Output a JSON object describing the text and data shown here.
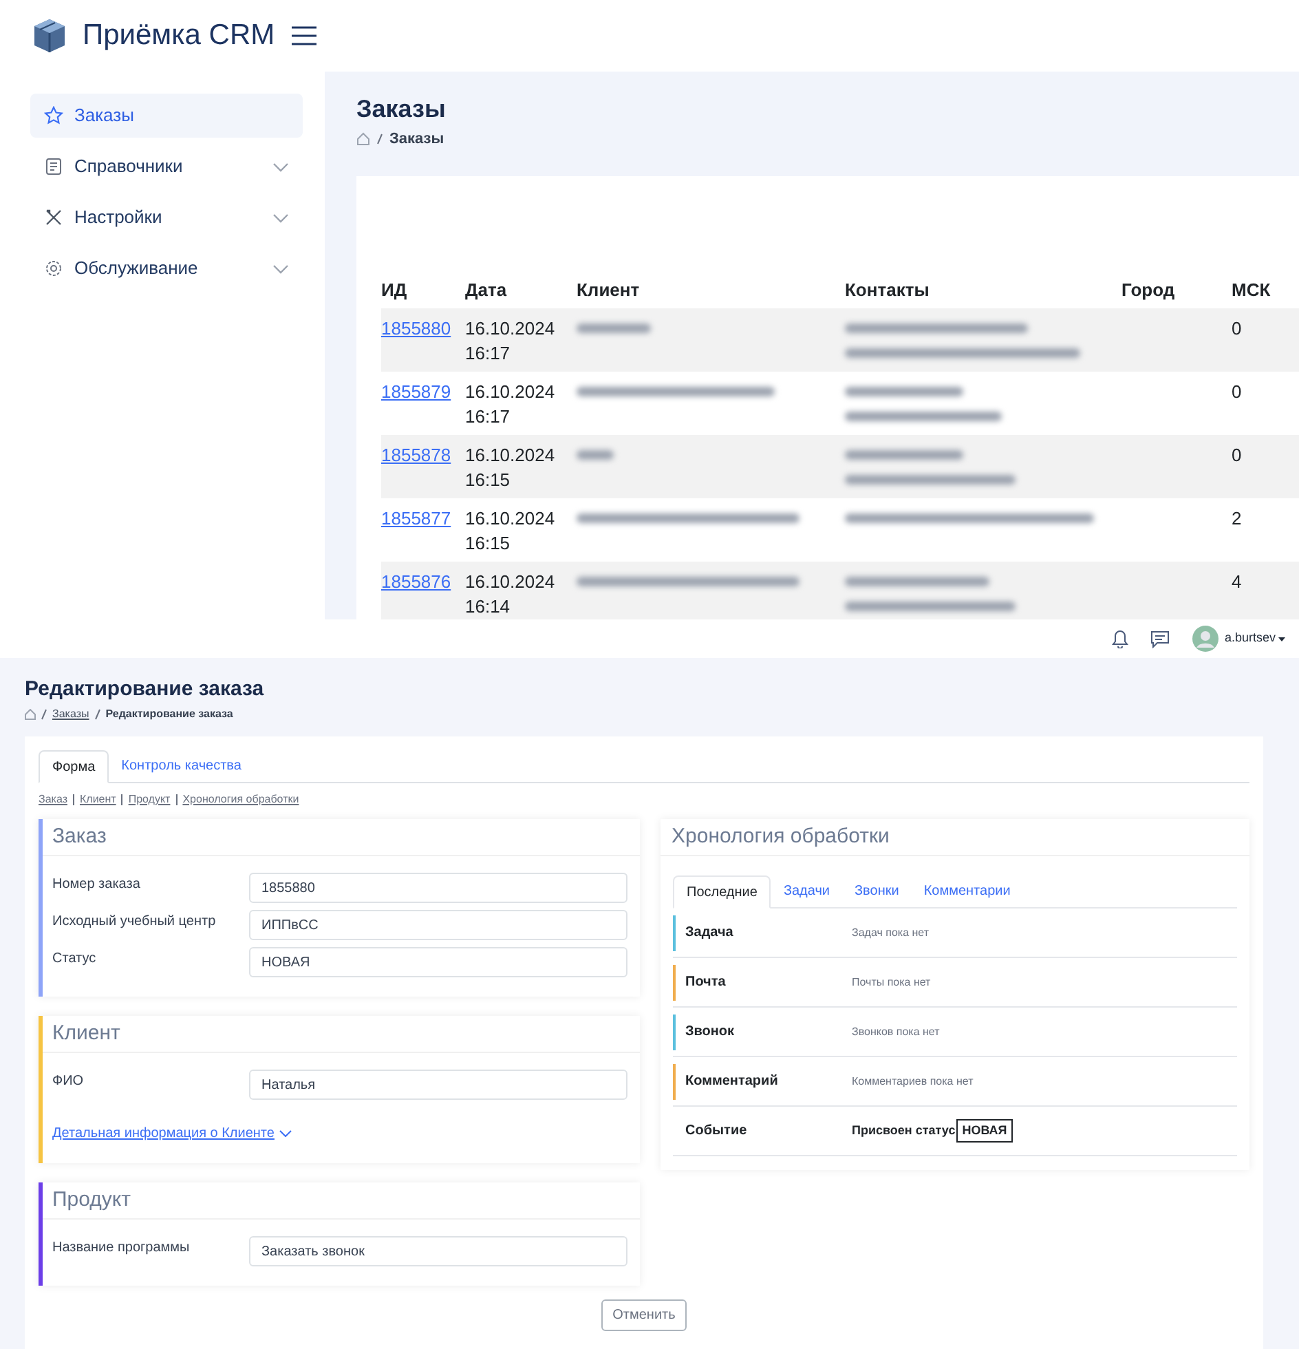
{
  "orders_screen": {
    "app_title": "Приёмка CRM",
    "sidebar": {
      "items": [
        {
          "label": "Заказы",
          "selected": true,
          "expandable": false
        },
        {
          "label": "Справочники",
          "selected": false,
          "expandable": true
        },
        {
          "label": "Настройки",
          "selected": false,
          "expandable": true
        },
        {
          "label": "Обслуживание",
          "selected": false,
          "expandable": true
        }
      ]
    },
    "page_title": "Заказы",
    "breadcrumb": [
      "Заказы"
    ],
    "table": {
      "columns": [
        "ИД",
        "Дата",
        "Клиент",
        "Контакты",
        "Город",
        "МСК"
      ],
      "rows": [
        {
          "id": "1855880",
          "date": "16.10.2024",
          "time": "16:17",
          "msk": "0"
        },
        {
          "id": "1855879",
          "date": "16.10.2024",
          "time": "16:17",
          "msk": "0"
        },
        {
          "id": "1855878",
          "date": "16.10.2024",
          "time": "16:15",
          "msk": "0"
        },
        {
          "id": "1855877",
          "date": "16.10.2024",
          "time": "16:15",
          "msk": "2"
        },
        {
          "id": "1855876",
          "date": "16.10.2024",
          "time": "16:14",
          "msk": "4"
        }
      ]
    }
  },
  "edit_screen": {
    "user": "a.burtsev",
    "page_title": "Редактирование заказа",
    "breadcrumb": [
      "Заказы",
      "Редактирование заказа"
    ],
    "tabs": [
      {
        "label": "Форма",
        "selected": true
      },
      {
        "label": "Контроль качества",
        "selected": false
      }
    ],
    "anchors": [
      "Заказ",
      "Клиент",
      "Продукт",
      "Хронология обработки"
    ],
    "sections": [
      {
        "title": "Заказ",
        "color": "#8ea4f8",
        "fields": [
          {
            "label": "Номер заказа",
            "value": "1855880"
          },
          {
            "label": "Исходный учебный центр",
            "value": "ИППвСС"
          },
          {
            "label": "Статус",
            "value": "НОВАЯ"
          }
        ]
      },
      {
        "title": "Клиент",
        "color": "#f6c443",
        "fields": [
          {
            "label": "ФИО",
            "value": "Наталья"
          }
        ],
        "link": "Детальная информация о Клиенте"
      },
      {
        "title": "Продукт",
        "color": "#6c3ee8",
        "fields": [
          {
            "label": "Название программы",
            "value": "Заказать звонок"
          }
        ]
      }
    ],
    "timeline": {
      "title": "Хронология обработки",
      "tabs": [
        {
          "label": "Последние",
          "selected": true
        },
        {
          "label": "Задачи",
          "selected": false
        },
        {
          "label": "Звонки",
          "selected": false
        },
        {
          "label": "Комментарии",
          "selected": false
        }
      ],
      "rows": [
        {
          "kind": "empty",
          "label": "Задача",
          "text": "Задач пока нет",
          "color": "#5bc0de"
        },
        {
          "kind": "empty",
          "label": "Почта",
          "text": "Почты пока нет",
          "color": "#f0ad4e"
        },
        {
          "kind": "empty",
          "label": "Звонок",
          "text": "Звонков пока нет",
          "color": "#5bc0de"
        },
        {
          "kind": "empty",
          "label": "Комментарий",
          "text": "Комментариев пока нет",
          "color": "#f0ad4e"
        },
        {
          "kind": "event",
          "label": "Событие",
          "text": "Присвоен статус",
          "badge": "НОВАЯ"
        }
      ]
    },
    "cancel_button": "Отменить"
  }
}
